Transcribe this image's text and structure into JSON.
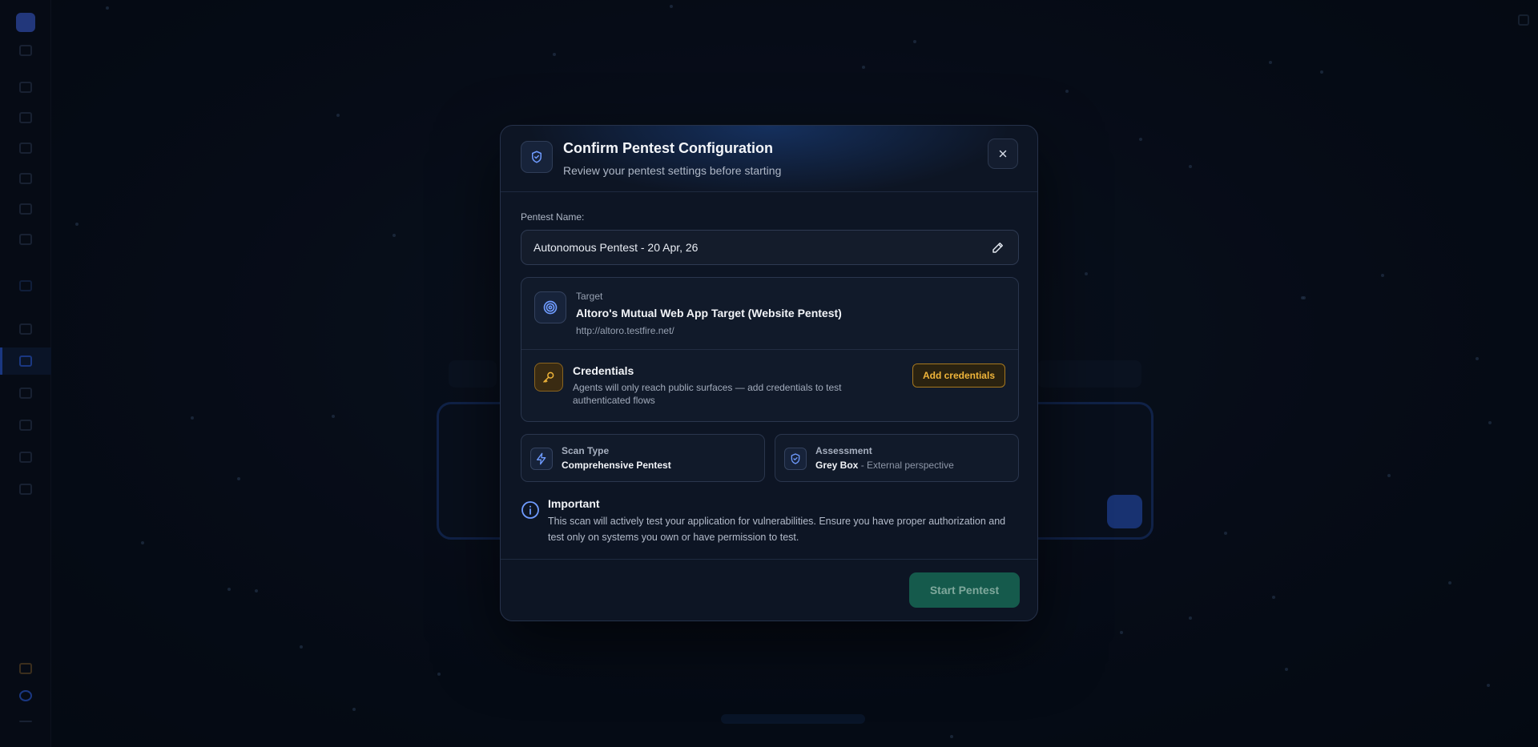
{
  "modal": {
    "title": "Confirm Pentest Configuration",
    "subtitle": "Review your pentest settings before starting",
    "name_label": "Pentest Name:",
    "name_value": "Autonomous Pentest - 20 Apr, 26",
    "target": {
      "label": "Target",
      "name": "Altoro's Mutual Web App Target (Website Pentest)",
      "url": "http://altoro.testfire.net/"
    },
    "credentials": {
      "title": "Credentials",
      "description": "Agents will only reach public surfaces — add credentials to test authenticated flows",
      "button_label": "Add credentials"
    },
    "scan_type": {
      "label": "Scan Type",
      "value": "Comprehensive Pentest"
    },
    "assessment": {
      "label": "Assessment",
      "value": "Grey Box",
      "detail": " - External perspective"
    },
    "important": {
      "title": "Important",
      "text": "This scan will actively test your application for vulnerabilities. Ensure you have proper authorization and test only on systems you own or have permission to test."
    },
    "start_button_label": "Start Pentest"
  },
  "icons": {
    "header": "shield-check-icon",
    "close": "close-icon",
    "edit": "pencil-icon",
    "target": "target-icon",
    "credentials": "key-icon",
    "scan_type": "lightning-icon",
    "assessment": "shield-check-icon",
    "important": "info-icon"
  },
  "colors": {
    "accent_blue": "#5b8cff",
    "credentials_amber": "#f0b53a",
    "start_button": "#155a4c"
  }
}
